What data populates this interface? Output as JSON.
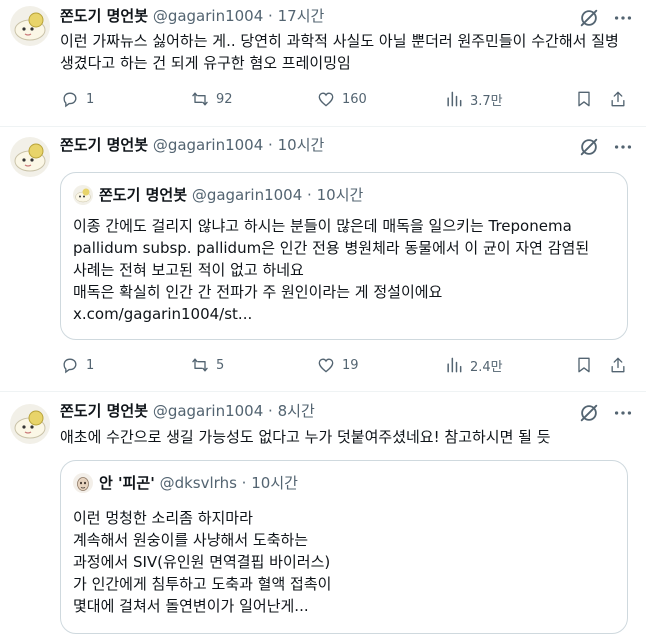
{
  "tweets": [
    {
      "name": "쫀도기 명언봇",
      "handle": "@gagarin1004",
      "time": "17시간",
      "text": "이런 가짜뉴스 싫어하는 게.. 당연히 과학적 사실도 아닐 뿐더러 원주민들이 수간해서 질병 생겼다고 하는 건 되게 유구한 혐오 프레이밍임",
      "replies": "1",
      "retweets": "92",
      "likes": "160",
      "views": "3.7만"
    },
    {
      "name": "쫀도기 명언봇",
      "handle": "@gagarin1004",
      "time": "10시간",
      "quote": {
        "name": "쫀도기 명언봇",
        "handle": "@gagarin1004",
        "time": "10시간",
        "lines": [
          "이종 간에도 걸리지 않냐고 하시는 분들이 많은데 매독을 일으키는 Treponema",
          "pallidum subsp. pallidum은 인간 전용 병원체라 동물에서 이 균이 자연 감염된",
          "사례는 전혀 보고된 적이 없고 하네요",
          "매독은 확실히 인간 간 전파가 주 원인이라는 게 정설이에요",
          "x.com/gagarin1004/st..."
        ]
      },
      "replies": "1",
      "retweets": "5",
      "likes": "19",
      "views": "2.4만"
    },
    {
      "name": "쫀도기 명언봇",
      "handle": "@gagarin1004",
      "time": "8시간",
      "text": "애초에 수간으로 생길 가능성도 없다고 누가 덧붙여주셨네요! 참고하시면 될 듯",
      "quote": {
        "name": "안 '피곤'",
        "handle": "@dksvlrhs",
        "time": "10시간",
        "lines": [
          "이런 멍청한 소리좀 하지마라",
          "계속해서 원숭이를 사냥해서 도축하는",
          "과정에서 SIV(유인원 면역결핍 바이러스)",
          "가 인간에게 침투하고 도축과 혈액 접촉이",
          "몇대에 걸쳐서 돌연변이가 일어난게..."
        ]
      }
    }
  ],
  "separator": "·",
  "colors": {
    "text": "#0f1419",
    "muted": "#536471",
    "border": "#cfd9de",
    "divider": "#eff3f4"
  },
  "icons": [
    "grok-icon",
    "more-icon",
    "reply-icon",
    "retweet-icon",
    "like-icon",
    "views-icon",
    "bookmark-icon",
    "share-icon"
  ]
}
